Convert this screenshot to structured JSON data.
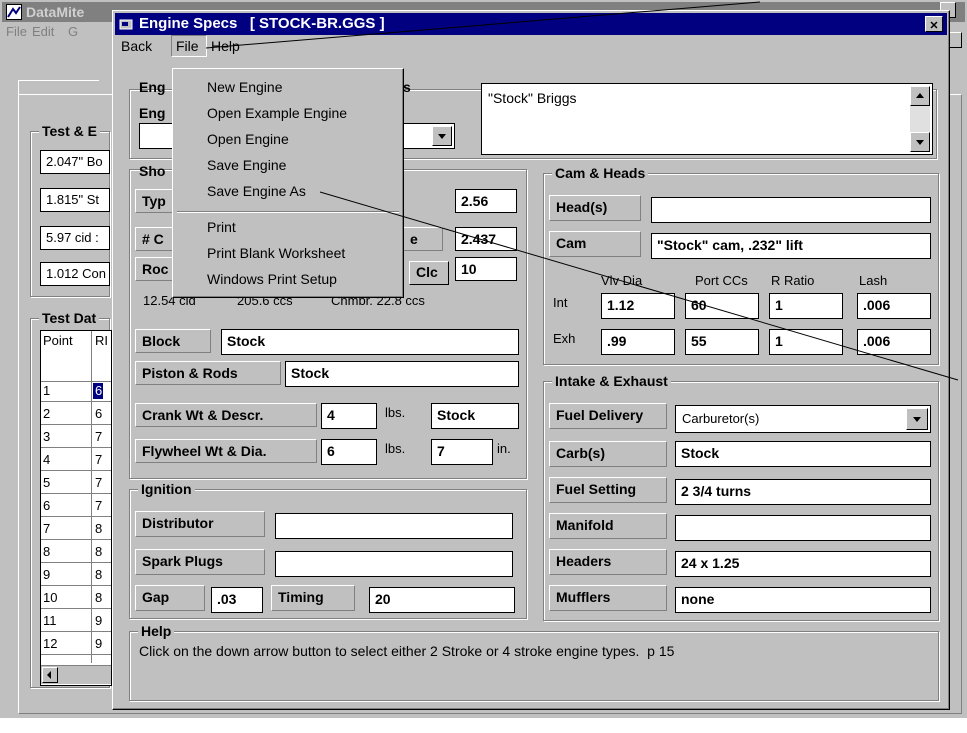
{
  "bg_window": {
    "title": "DataMite",
    "menu": [
      "File",
      "Edit",
      "G"
    ],
    "test_engine_label": "Test & E",
    "test_engine_items": [
      "2.047\" Bo",
      "1.815\" St",
      "5.97 cid :",
      "1.012 Con"
    ],
    "test_data_label": "Test Dat",
    "table_headers": [
      "Point",
      "RI"
    ],
    "rows": [
      {
        "point": "1",
        "rpm": "6"
      },
      {
        "point": "2",
        "rpm": "6"
      },
      {
        "point": "3",
        "rpm": "7"
      },
      {
        "point": "4",
        "rpm": "7"
      },
      {
        "point": "5",
        "rpm": "7"
      },
      {
        "point": "6",
        "rpm": "7"
      },
      {
        "point": "7",
        "rpm": "8"
      },
      {
        "point": "8",
        "rpm": "8"
      },
      {
        "point": "9",
        "rpm": "8"
      },
      {
        "point": "10",
        "rpm": "8"
      },
      {
        "point": "11",
        "rpm": "9"
      },
      {
        "point": "12",
        "rpm": "9"
      }
    ]
  },
  "dialog": {
    "title": "Engine Specs   [ STOCK-BR.GGS ]",
    "close_glyph": "✕",
    "menu": {
      "back": "Back",
      "file": "File",
      "help": "Help"
    },
    "file_menu": {
      "group1": [
        "New Engine",
        "Open Example Engine",
        "Open Engine",
        "Save Engine",
        "Save Engine As"
      ],
      "group2": [
        "Print",
        "Print Blank Worksheet",
        "Windows Print Setup"
      ]
    },
    "engine_group_label_left": "Eng",
    "engine_group_label_right": "s",
    "engine_field_label": "Eng",
    "engine_type_value": "",
    "comments": "\"Stock\" Briggs",
    "short_block": {
      "label": "Sho",
      "type_label": "Typ",
      "type_value": "2.56",
      "cyl_label": "# C",
      "stroke_label": "e",
      "stroke_value": "2.437",
      "rod_label": "Roc",
      "clc_label": "Clc",
      "rod_value": "10",
      "calc_line": [
        "12.54 cid",
        "205.6 ccs",
        "Chmbr. 22.8 ccs"
      ],
      "block_label": "Block",
      "block_value": "Stock",
      "piston_label": "Piston & Rods",
      "piston_value": "Stock",
      "crank_label": "Crank Wt & Descr.",
      "crank_wt": "4",
      "crank_unit": "lbs.",
      "crank_descr": "Stock",
      "flywheel_label": "Flywheel Wt & Dia.",
      "flywheel_wt": "6",
      "flywheel_unit": "lbs.",
      "flywheel_dia": "7",
      "flywheel_dia_unit": "in."
    },
    "ignition": {
      "title": "Ignition",
      "distributor_label": "Distributor",
      "distributor_value": "",
      "plugs_label": "Spark Plugs",
      "plugs_value": "",
      "gap_label": "Gap",
      "gap_value": ".03",
      "timing_label": "Timing",
      "timing_value": "20"
    },
    "cam_heads": {
      "title": "Cam & Heads",
      "heads_label": "Head(s)",
      "heads_value": "",
      "cam_label": "Cam",
      "cam_value": "\"Stock\" cam, .232\" lift",
      "col_headers": [
        "Vlv Dia",
        "Port CCs",
        "R Ratio",
        "Lash"
      ],
      "int_label": "Int",
      "int_values": [
        "1.12",
        "60",
        "1",
        ".006"
      ],
      "exh_label": "Exh",
      "exh_values": [
        ".99",
        "55",
        "1",
        ".006"
      ]
    },
    "intake_exhaust": {
      "title": "Intake & Exhaust",
      "fuel_delivery_label": "Fuel Delivery",
      "fuel_delivery_value": "Carburetor(s)",
      "carbs_label": "Carb(s)",
      "carbs_value": "Stock",
      "fuel_setting_label": "Fuel Setting",
      "fuel_setting_value": "2 3/4 turns",
      "manifold_label": "Manifold",
      "manifold_value": "",
      "headers_label": "Headers",
      "headers_value": "24 x 1.25",
      "mufflers_label": "Mufflers",
      "mufflers_value": "none"
    },
    "help": {
      "title": "Help",
      "text": "Click on the down arrow button to select either 2 Stroke or 4 stroke engine types.  p 15"
    }
  },
  "colors": {
    "title_bar": "#000080",
    "face": "#c0c0c0",
    "selection": "#000080"
  }
}
